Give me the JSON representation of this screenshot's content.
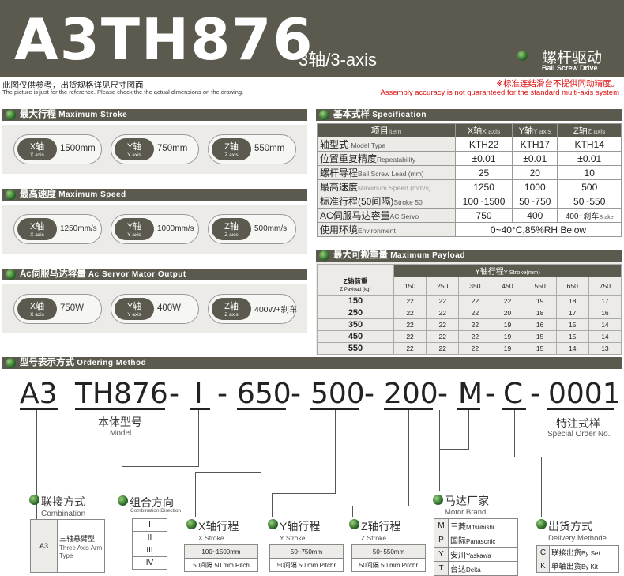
{
  "header": {
    "title": "A3TH876",
    "subtitle": "3轴/3-axis",
    "drive_cn": "螺杆驱动",
    "drive_en": "Ball Screw Drive"
  },
  "notes": {
    "left_cn": "此图仅供参考，出货规格详见尺寸图面",
    "left_en": "The picture is just for the reference. Please check the the actual dimensions on the drawing.",
    "right_cn": "※标准连结滑台不提供同动精度。",
    "right_en": "Assembly accuracy is not guaranteed for the standard multi-axis system"
  },
  "sections": {
    "max_stroke": {
      "cn": "最大行程",
      "en": "Maximum Stroke"
    },
    "max_speed": {
      "cn": "最高速度",
      "en": "Maximum Speed"
    },
    "servo": {
      "cn": "Ac伺服马达容量",
      "en": "Ac Servor Mator Output"
    },
    "spec": {
      "cn": "基本式样",
      "en": "Specification"
    },
    "payload": {
      "cn": "最大可搬重量",
      "en": "Maximum Payload"
    },
    "ordering": {
      "cn": "型号表示方式",
      "en": "Ordering Method"
    }
  },
  "axes": [
    {
      "cn": "X轴",
      "en": "X axis"
    },
    {
      "cn": "Y轴",
      "en": "Y axis"
    },
    {
      "cn": "Z轴",
      "en": "Z axis"
    }
  ],
  "stroke_vals": [
    "1500mm",
    "750mm",
    "550mm"
  ],
  "speed_vals": [
    "1250mm/s",
    "1000mm/s",
    "500mm/s"
  ],
  "servo_vals": [
    "750W",
    "400W",
    "400W+刹车"
  ],
  "spec_table": {
    "headers": [
      "项目",
      "Item",
      "X轴",
      "X axis",
      "Y轴",
      "Y axis",
      "Z轴",
      "Z axis"
    ],
    "rows": [
      {
        "cn": "轴型式",
        "en": "Model Type",
        "x": "KTH22",
        "y": "KTH17",
        "z": "KTH14"
      },
      {
        "cn": "位置重复精度",
        "en": "Repeatability",
        "x": "±0.01",
        "y": "±0.01",
        "z": "±0.01"
      },
      {
        "cn": "螺杆导程",
        "en": "Ball Screw Lead (mm)",
        "x": "25",
        "y": "20",
        "z": "10"
      },
      {
        "cn": "最高速度",
        "en": "Maximum Speed (mm/s)",
        "x": "1250",
        "y": "1000",
        "z": "500"
      },
      {
        "cn": "标准行程(50间隔)",
        "en": "Stroke 50",
        "x": "100~1500",
        "y": "50~750",
        "z": "50~550"
      },
      {
        "cn": "AC伺服马达容量",
        "en": "AC Servo",
        "x": "750",
        "y": "400",
        "z": "400+刹车",
        "z_en": "Brake"
      }
    ],
    "env_cn": "使用环境",
    "env_en": "Environment",
    "env_val": "0~40°C,85%RH Below"
  },
  "payload_table": {
    "y_header_cn": "Y轴行程",
    "y_header_en": "Y Stroke(mm)",
    "z_header_cn": "Z轴荷重",
    "z_header_en": "Z Payload (kg)",
    "cols": [
      "150",
      "250",
      "350",
      "450",
      "550",
      "650",
      "750"
    ],
    "rows": [
      {
        "z": "150",
        "v": [
          "22",
          "22",
          "22",
          "22",
          "19",
          "18",
          "17"
        ]
      },
      {
        "z": "250",
        "v": [
          "22",
          "22",
          "22",
          "20",
          "18",
          "17",
          "16"
        ]
      },
      {
        "z": "350",
        "v": [
          "22",
          "22",
          "22",
          "19",
          "16",
          "15",
          "14"
        ]
      },
      {
        "z": "450",
        "v": [
          "22",
          "22",
          "22",
          "19",
          "15",
          "15",
          "14"
        ]
      },
      {
        "z": "550",
        "v": [
          "22",
          "22",
          "22",
          "19",
          "15",
          "14",
          "13"
        ]
      }
    ]
  },
  "ordering": {
    "code": [
      "A3",
      "TH876",
      "-",
      "I",
      "-",
      "650",
      "-",
      "500",
      "-",
      "200",
      "-",
      "M",
      "-",
      "C",
      "-",
      "0001"
    ],
    "body_cn": "本体型号",
    "body_en": "Model",
    "special_cn": "特注式样",
    "special_en": "Special Order No.",
    "conn_cn": "联接方式",
    "conn_en": "Combination",
    "conn_code": "A3",
    "conn_desc_cn": "三轴悬臂型",
    "conn_desc_en": "Three Axis Arm Type",
    "dir_cn": "组合方向",
    "dir_en": "Combination Direction",
    "dir_opts": [
      "I",
      "II",
      "III",
      "IV"
    ],
    "x_cn": "X轴行程",
    "x_en": "X Stroke",
    "x_range": "100~1500mm",
    "x_pitch": "50间隔 50 mm Pitch",
    "y_cn": "Y轴行程",
    "y_en": "Y Stroke",
    "y_range": "50~750mm",
    "y_pitch": "50间隔 50 mm Pitchr",
    "z_cn": "Z轴行程",
    "z_en": "Z Stroke",
    "z_range": "50~550mm",
    "z_pitch": "50间隔 50 mm Pitchr",
    "motor_cn": "马达厂家",
    "motor_en": "Motor Brand",
    "motors": [
      {
        "k": "M",
        "cn": "三菱",
        "en": "Mitsubishi"
      },
      {
        "k": "P",
        "cn": "国际",
        "en": "Panasonic"
      },
      {
        "k": "Y",
        "cn": "安川",
        "en": "Yaskawa"
      },
      {
        "k": "T",
        "cn": "台达",
        "en": "Delta"
      }
    ],
    "deliv_cn": "出货方式",
    "deliv_en": "Delivery Methode",
    "delivs": [
      {
        "k": "C",
        "cn": "联接出货",
        "en": "By Set"
      },
      {
        "k": "K",
        "cn": "单轴出货",
        "en": "By Kit"
      }
    ]
  }
}
